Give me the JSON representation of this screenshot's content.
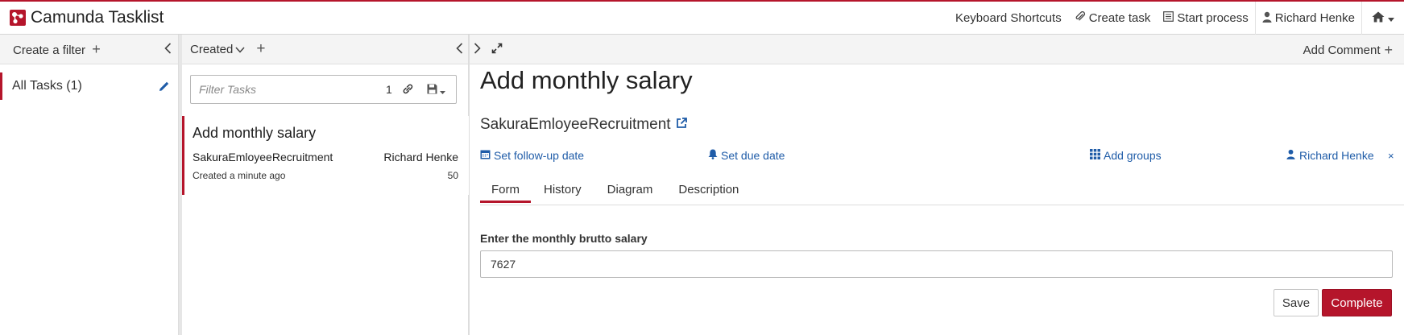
{
  "app": {
    "title": "Camunda Tasklist"
  },
  "topnav": {
    "shortcuts": "Keyboard Shortcuts",
    "create_task": "Create task",
    "start_process": "Start process",
    "user": "Richard Henke"
  },
  "filters": {
    "header": "Create a filter",
    "items": [
      {
        "label": "All Tasks (1)"
      }
    ]
  },
  "list": {
    "sort_label": "Created",
    "filter_placeholder": "Filter Tasks",
    "filter_count": "1",
    "tasks": [
      {
        "name": "Add monthly salary",
        "process": "SakuraEmloyeeRecruitment",
        "assignee": "Richard Henke",
        "created": "Created a minute ago",
        "priority": "50"
      }
    ]
  },
  "task": {
    "add_comment": "Add Comment",
    "title": "Add monthly salary",
    "process": "SakuraEmloyeeRecruitment",
    "actions": {
      "follow_up": "Set follow-up date",
      "due": "Set due date",
      "groups": "Add groups",
      "assignee": "Richard Henke",
      "unassign": "×"
    },
    "tabs": [
      "Form",
      "History",
      "Diagram",
      "Description"
    ],
    "form": {
      "field_label": "Enter the monthly brutto salary",
      "field_value": "7627",
      "save": "Save",
      "complete": "Complete"
    }
  },
  "colors": {
    "accent": "#b5152b",
    "link": "#1f5ca8"
  }
}
